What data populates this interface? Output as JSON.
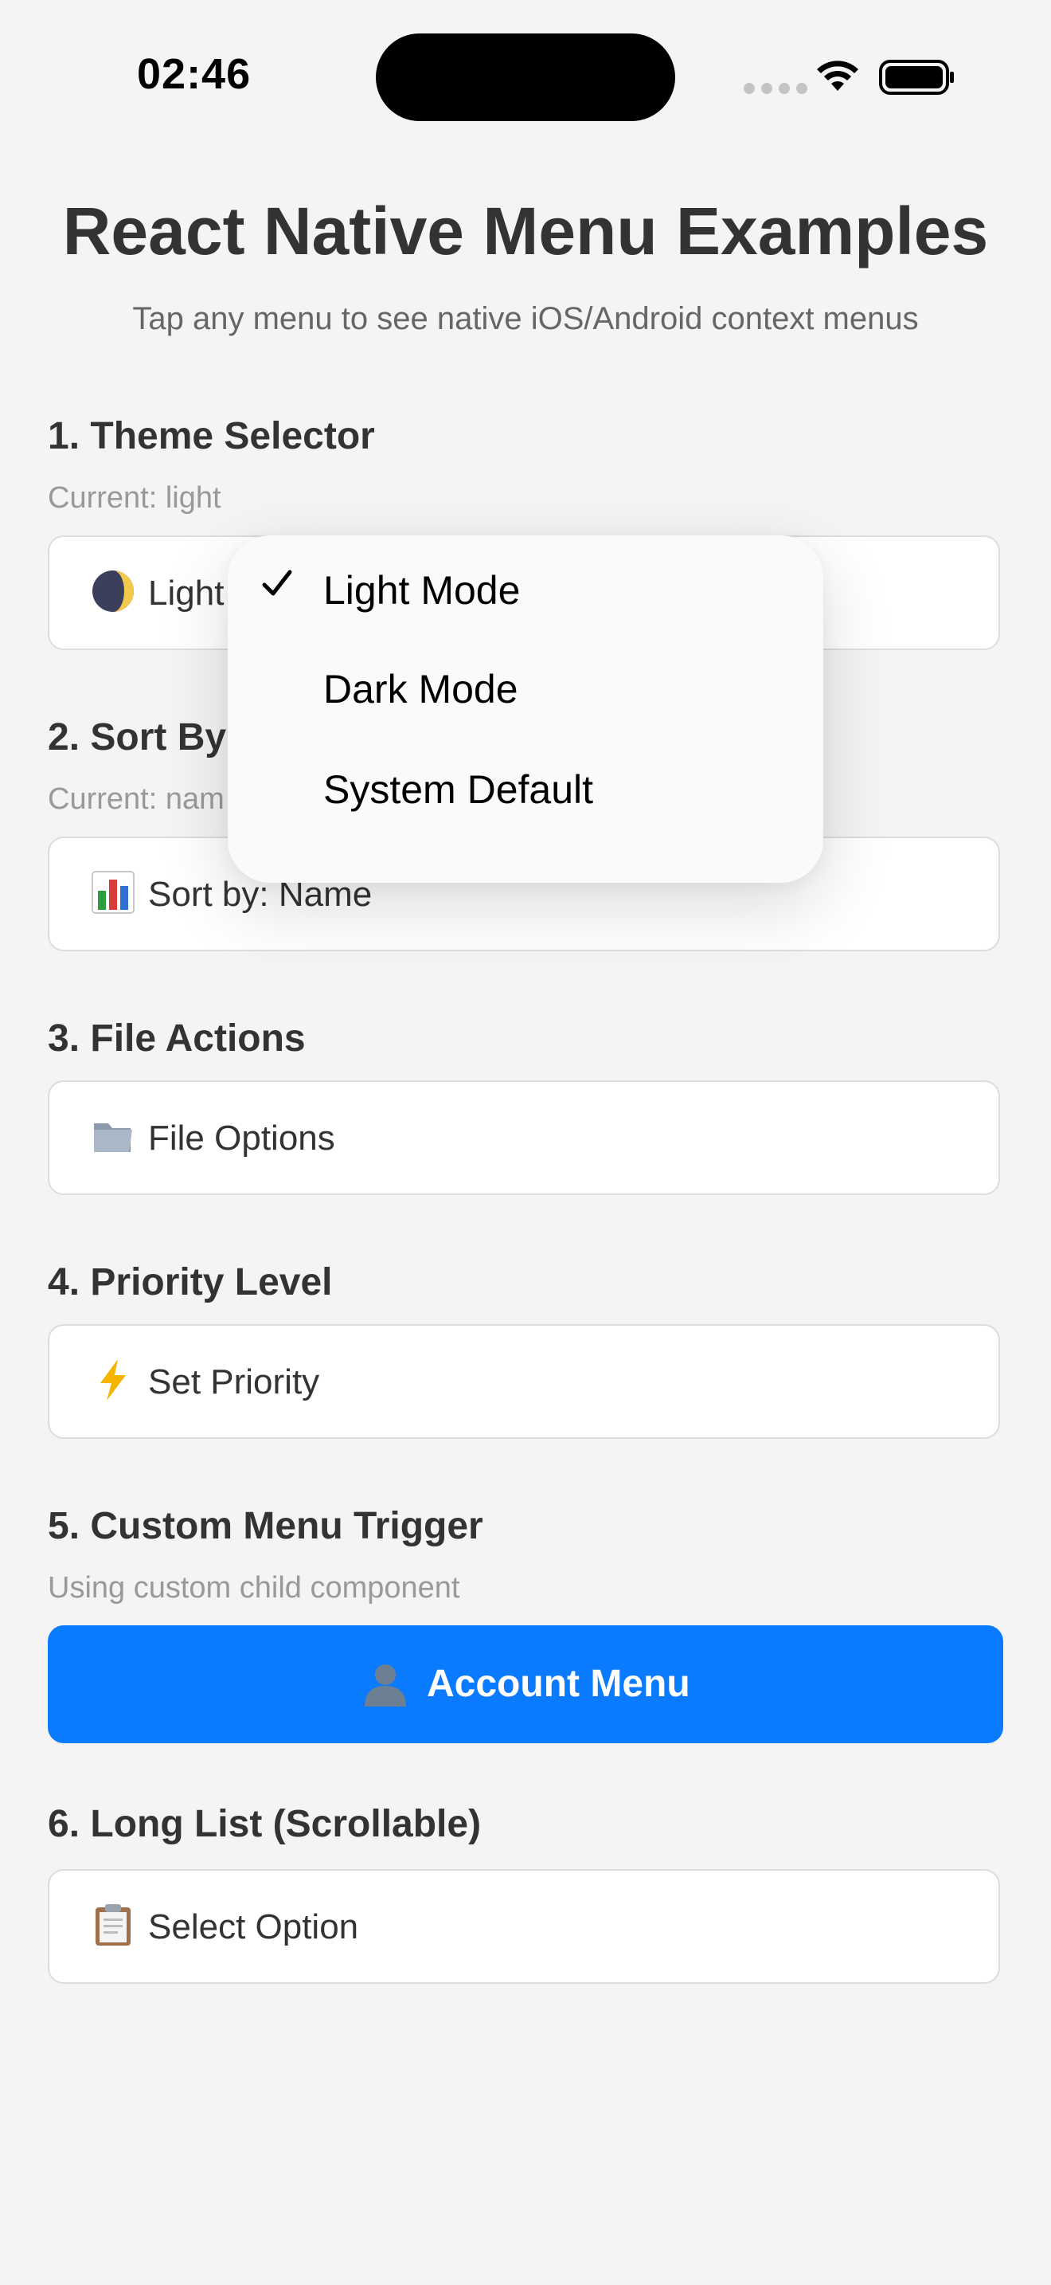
{
  "status_bar": {
    "time": "02:46"
  },
  "header": {
    "title": "React Native Menu Examples",
    "subtitle": "Tap any menu to see native iOS/Android context menus"
  },
  "sections": [
    {
      "title": "1. Theme Selector",
      "caption": "Current: light",
      "button_label": "Light",
      "icon": "moon-icon"
    },
    {
      "title": "2. Sort By",
      "caption": "Current: nam",
      "button_label": "Sort by: Name",
      "icon": "bar-chart-icon"
    },
    {
      "title": "3. File Actions",
      "button_label": "File Options",
      "icon": "folder-icon"
    },
    {
      "title": "4. Priority Level",
      "button_label": "Set Priority",
      "icon": "lightning-icon"
    },
    {
      "title": "5. Custom Menu Trigger",
      "caption": "Using custom child component",
      "button_label": "Account Menu",
      "icon": "person-icon"
    },
    {
      "title": "6. Long List (Scrollable)",
      "button_label": "Select Option",
      "icon": "clipboard-icon"
    }
  ],
  "context_menu": {
    "items": [
      {
        "label": "Light Mode",
        "checked": true
      },
      {
        "label": "Dark Mode",
        "checked": false
      },
      {
        "label": "System Default",
        "checked": false
      }
    ]
  },
  "colors": {
    "background": "#f4f4f4",
    "primary": "#0a7aff",
    "text": "#333333",
    "caption": "#999999"
  }
}
